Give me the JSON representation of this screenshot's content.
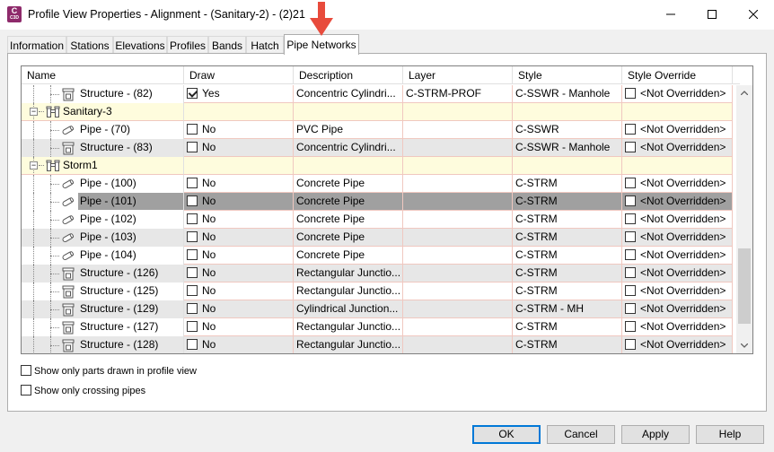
{
  "window": {
    "title": "Profile View Properties - Alignment - (Sanitary-2) - (2)21",
    "app_icon_letter": "C",
    "app_icon_sub": "C3D"
  },
  "tabs": [
    {
      "label": "Information",
      "active": false
    },
    {
      "label": "Stations",
      "active": false
    },
    {
      "label": "Elevations",
      "active": false
    },
    {
      "label": "Profiles",
      "active": false
    },
    {
      "label": "Bands",
      "active": false
    },
    {
      "label": "Hatch",
      "active": false
    },
    {
      "label": "Pipe Networks",
      "active": true
    }
  ],
  "grid": {
    "columns": [
      "Name",
      "Draw",
      "Description",
      "Layer",
      "Style",
      "Style Override"
    ],
    "rows": [
      {
        "kind": "structure",
        "name": "Structure - (82)",
        "draw_checked": true,
        "draw": "Yes",
        "description": "Concentric Cylindri...",
        "layer": "C-STRM-PROF",
        "style": "C-SSWR - Manhole",
        "override": "<Not Overridden>"
      },
      {
        "kind": "group",
        "name": "Sanitary-3"
      },
      {
        "kind": "pipe",
        "name": "Pipe - (70)",
        "draw_checked": false,
        "draw": "No",
        "description": "PVC Pipe",
        "layer": "",
        "style": "C-SSWR",
        "override": "<Not Overridden>"
      },
      {
        "kind": "structure",
        "name": "Structure - (83)",
        "draw_checked": false,
        "draw": "No",
        "description": "Concentric Cylindri...",
        "layer": "",
        "style": "C-SSWR - Manhole",
        "override": "<Not Overridden>"
      },
      {
        "kind": "group",
        "name": "Storm1"
      },
      {
        "kind": "pipe",
        "name": "Pipe - (100)",
        "draw_checked": false,
        "draw": "No",
        "description": "Concrete Pipe",
        "layer": "",
        "style": "C-STRM",
        "override": "<Not Overridden>"
      },
      {
        "kind": "pipe",
        "name": "Pipe - (101)",
        "draw_checked": false,
        "draw": "No",
        "description": "Concrete Pipe",
        "layer": "",
        "style": "C-STRM",
        "override": "<Not Overridden>",
        "selected": true
      },
      {
        "kind": "pipe",
        "name": "Pipe - (102)",
        "draw_checked": false,
        "draw": "No",
        "description": "Concrete Pipe",
        "layer": "",
        "style": "C-STRM",
        "override": "<Not Overridden>"
      },
      {
        "kind": "pipe",
        "name": "Pipe - (103)",
        "draw_checked": false,
        "draw": "No",
        "description": "Concrete Pipe",
        "layer": "",
        "style": "C-STRM",
        "override": "<Not Overridden>"
      },
      {
        "kind": "pipe",
        "name": "Pipe - (104)",
        "draw_checked": false,
        "draw": "No",
        "description": "Concrete Pipe",
        "layer": "",
        "style": "C-STRM",
        "override": "<Not Overridden>"
      },
      {
        "kind": "structure",
        "name": "Structure - (126)",
        "draw_checked": false,
        "draw": "No",
        "description": "Rectangular Junctio...",
        "layer": "",
        "style": "C-STRM",
        "override": "<Not Overridden>"
      },
      {
        "kind": "structure",
        "name": "Structure - (125)",
        "draw_checked": false,
        "draw": "No",
        "description": "Rectangular Junctio...",
        "layer": "",
        "style": "C-STRM",
        "override": "<Not Overridden>"
      },
      {
        "kind": "structure",
        "name": "Structure - (129)",
        "draw_checked": false,
        "draw": "No",
        "description": "Cylindrical Junction...",
        "layer": "",
        "style": "C-STRM - MH",
        "override": "<Not Overridden>"
      },
      {
        "kind": "structure",
        "name": "Structure - (127)",
        "draw_checked": false,
        "draw": "No",
        "description": "Rectangular Junctio...",
        "layer": "",
        "style": "C-STRM",
        "override": "<Not Overridden>"
      },
      {
        "kind": "structure",
        "name": "Structure - (128)",
        "draw_checked": false,
        "draw": "No",
        "description": "Rectangular Junctio...",
        "layer": "",
        "style": "C-STRM",
        "override": "<Not Overridden>"
      }
    ]
  },
  "options": {
    "show_parts_label": "Show only parts drawn in profile view",
    "show_crossing_label": "Show only crossing pipes"
  },
  "buttons": {
    "ok": "OK",
    "cancel": "Cancel",
    "apply": "Apply",
    "help": "Help"
  },
  "colors": {
    "annotation_arrow": "#e84b3c",
    "group_row": "#fefcdd",
    "selected_row": "#a0a0a0"
  }
}
